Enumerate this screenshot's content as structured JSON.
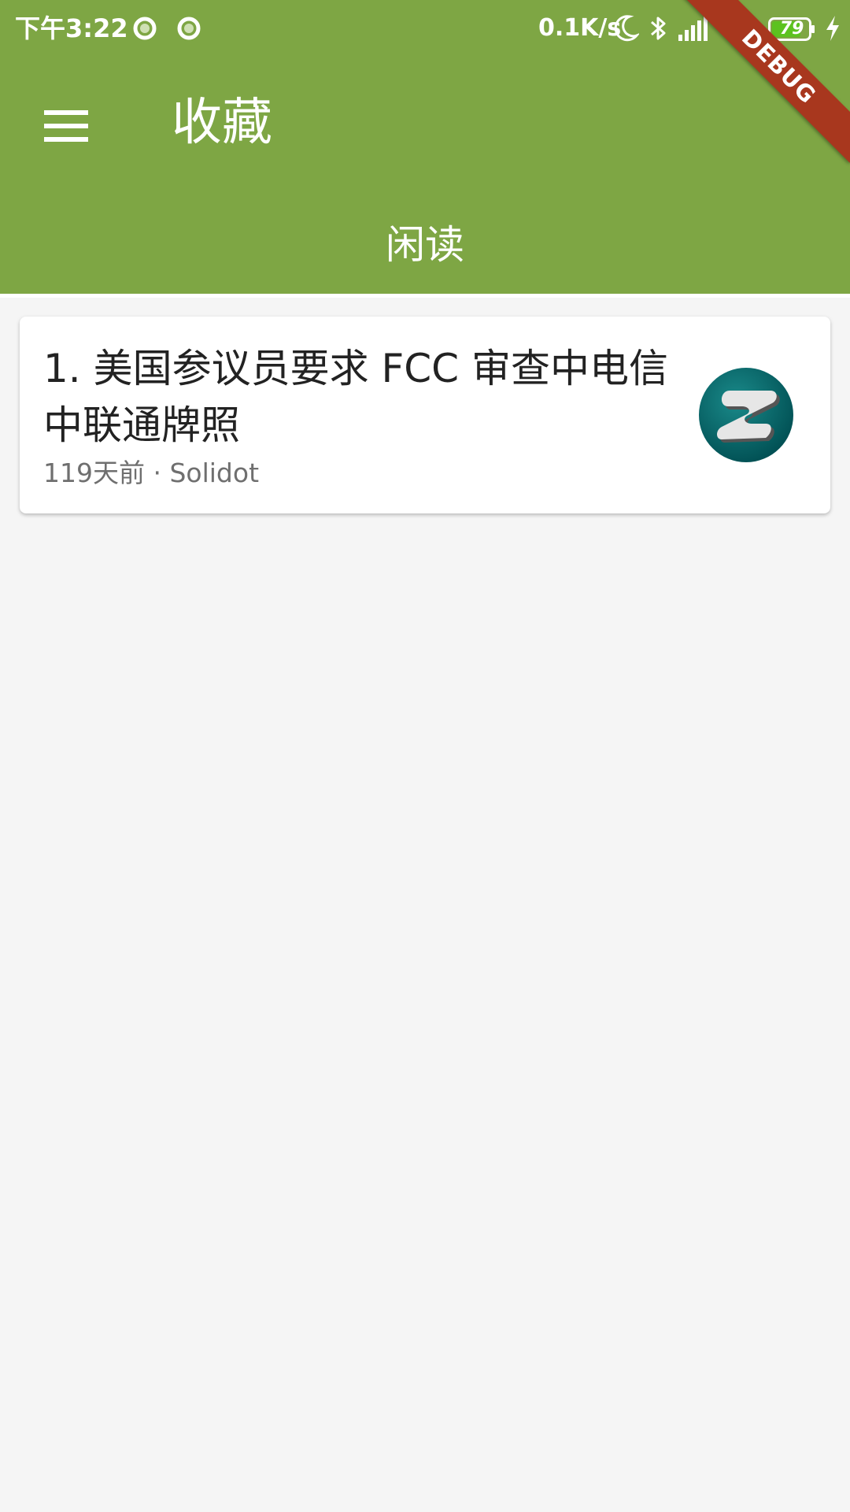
{
  "status_bar": {
    "time": "下午3:22",
    "net_speed": "0.1K/s",
    "battery": "79",
    "icons": [
      "notification-circle-icon",
      "notification-circle-icon",
      "moon-icon",
      "bluetooth-icon",
      "signal-icon",
      "wifi-icon",
      "battery-icon",
      "charging-icon"
    ]
  },
  "app_bar": {
    "title": "收藏",
    "menu_icon": "menu-icon",
    "background_color": "#7ea644"
  },
  "debug_banner": "DEBUG",
  "tabs": [
    {
      "label": "闲读",
      "selected": true
    }
  ],
  "items": [
    {
      "title": "1. 美国参议员要求 FCC 审查中电信中联通牌照",
      "meta": "119天前 · Solidot",
      "logo_icon": "solidot-logo-icon"
    }
  ]
}
